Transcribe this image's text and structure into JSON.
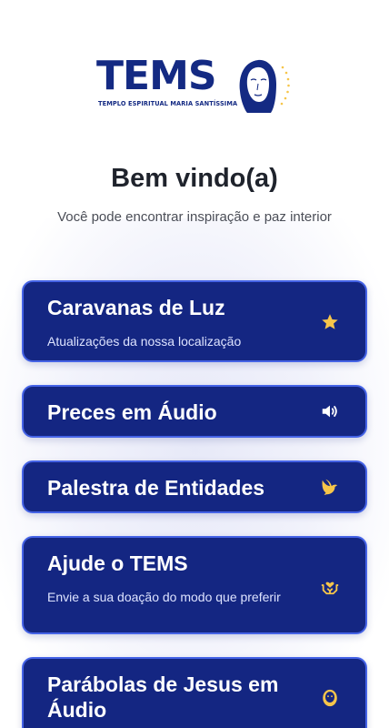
{
  "logo": {
    "wordmark": "TEMS",
    "subtitle": "TEMPLO ESPIRITUAL MARIA SANTÍSSIMA"
  },
  "header": {
    "title": "Bem vindo(a)",
    "tagline": "Você pode encontrar inspiração e paz interior"
  },
  "colors": {
    "card_background": "#142682",
    "card_border": "#4563e6",
    "icon_color": "#f6c54a",
    "brand_blue": "#142a83"
  },
  "menu": [
    {
      "title": "Caravanas de Luz",
      "subtitle": "Atualizações da nossa localização",
      "icon": "star-icon"
    },
    {
      "title": "Preces em Áudio",
      "subtitle": "",
      "icon": "speaker-icon"
    },
    {
      "title": "Palestra de Entidades",
      "subtitle": "",
      "icon": "dove-icon"
    },
    {
      "title": "Ajude o TEMS",
      "subtitle": "Envie a sua doação do modo que preferir",
      "icon": "donation-hands-icon"
    },
    {
      "title": "Parábolas de Jesus em Áudio",
      "subtitle": "",
      "icon": "jesus-face-icon"
    }
  ]
}
